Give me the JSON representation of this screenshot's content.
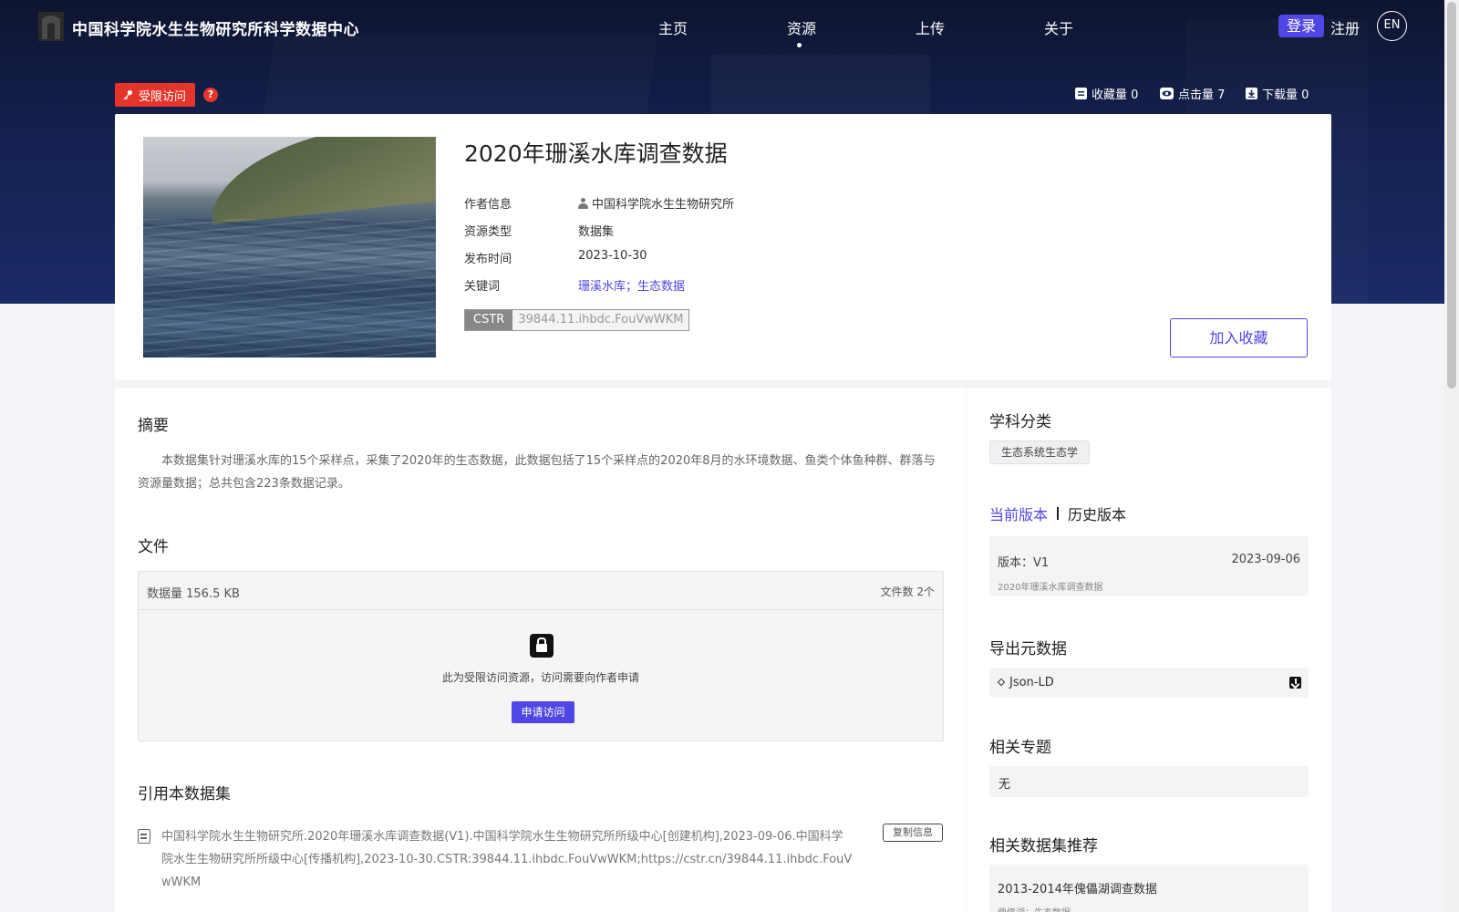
{
  "header": {
    "site_title": "中国科学院水生生物研究所科学数据中心",
    "nav": [
      "主页",
      "资源",
      "上传",
      "关于"
    ],
    "active_nav": "资源",
    "login": "登录",
    "register": "注册",
    "lang": "EN"
  },
  "access": {
    "badge": "受限访问",
    "help": "?"
  },
  "stats": {
    "favorites": "收藏量 0",
    "views": "点击量 7",
    "downloads": "下载量 0"
  },
  "dataset": {
    "title": "2020年珊溪水库调查数据",
    "meta": [
      {
        "label": "作者信息",
        "value": "中国科学院水生生物研究所"
      },
      {
        "label": "资源类型",
        "value": "数据集"
      },
      {
        "label": "发布时间",
        "value": "2023-10-30"
      },
      {
        "label": "关键词",
        "value": "珊溪水库；生态数据"
      }
    ],
    "cstr_label": "CSTR",
    "cstr_value": "39844.11.ihbdc.FouVwWKM",
    "favorite_button": "加入收藏"
  },
  "abstract": {
    "heading": "摘要",
    "text": "本数据集针对珊溪水库的15个采样点，采集了2020年的生态数据，此数据包括了15个采样点的2020年8月的水环境数据、鱼类个体鱼种群、群落与资源量数据；总共包含223条数据记录。"
  },
  "files": {
    "heading": "文件",
    "size": "数据量 156.5 KB",
    "count": "文件数 2个",
    "restricted_note": "此为受限访问资源，访问需要向作者申请",
    "apply_button": "申请访问"
  },
  "citation": {
    "heading": "引用本数据集",
    "text": "中国科学院水生生物研究所.2020年珊溪水库调查数据(V1).中国科学院水生生物研究所所级中心[创建机构],2023-09-06.中国科学院水生生物研究所所级中心[传播机构],2023-10-30.CSTR:39844.11.ihbdc.FouVwWKM;https://cstr.cn/39844.11.ihbdc.FouVwWKM",
    "copy_button": "复制信息"
  },
  "sidebar": {
    "subject_heading": "学科分类",
    "subject_tag": "生态系统生态学",
    "current_version_tab": "当前版本",
    "history_version_tab": "历史版本",
    "version": {
      "num": "版本：V1",
      "date": "2023-09-06",
      "name": "2020年珊溪水库调查数据"
    },
    "export_heading": "导出元数据",
    "export_format": "Json-LD",
    "topic_heading": "相关专题",
    "topic_value": "无",
    "recommend_heading": "相关数据集推荐",
    "recommend": {
      "title": "2013-2014年傀儡湖调查数据",
      "sub": "傀儡湖；生态数据"
    }
  },
  "colors": {
    "accent": "#5046e5",
    "restricted": "#e5342b",
    "header_bg": "#142050"
  }
}
